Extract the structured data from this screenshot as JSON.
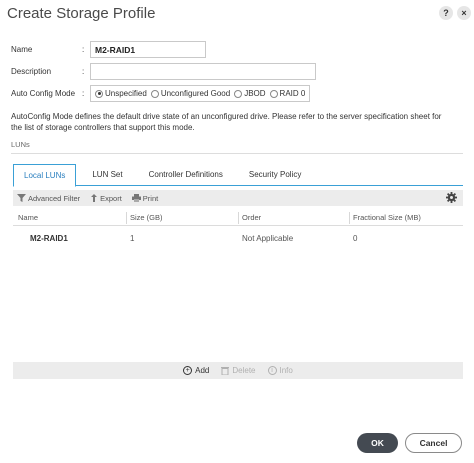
{
  "dialog": {
    "title": "Create Storage Profile",
    "help_label": "?",
    "close_label": "×"
  },
  "form": {
    "name_label": "Name",
    "name_value": "M2-RAID1",
    "description_label": "Description",
    "description_value": "",
    "autoconfig_label": "Auto Config Mode",
    "colon": ":",
    "autoconfig_options": [
      "Unspecified",
      "Unconfigured Good",
      "JBOD",
      "RAID 0"
    ],
    "autoconfig_selected": "Unspecified",
    "help_text": "AutoConfig Mode defines the default drive state of an unconfigured drive. Please refer to the server specification sheet for the list of storage controllers that support this mode."
  },
  "luns": {
    "section_label": "LUNs",
    "tabs": [
      "Local LUNs",
      "LUN Set",
      "Controller Definitions",
      "Security Policy"
    ],
    "active_tab": "Local LUNs",
    "toolbar": {
      "filter_label": "Advanced Filter",
      "export_label": "Export",
      "print_label": "Print"
    },
    "columns": [
      "Name",
      "Size (GB)",
      "Order",
      "Fractional Size (MB)"
    ],
    "rows": [
      {
        "name": "M2-RAID1",
        "size": "1",
        "order": "Not Applicable",
        "fractional": "0"
      }
    ],
    "actions": {
      "add_label": "Add",
      "delete_label": "Delete",
      "info_label": "Info"
    }
  },
  "buttons": {
    "ok_label": "OK",
    "cancel_label": "Cancel"
  },
  "colors": {
    "accent": "#3aa0d6",
    "ok_bg": "#444a52"
  }
}
